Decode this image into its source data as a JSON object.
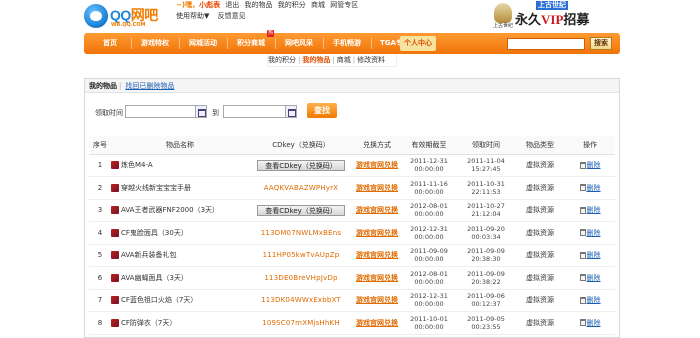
{
  "header": {
    "logo_main": "QQ",
    "logo_accent": "网吧",
    "logo_url": "WB.QQ.COM",
    "greet": "~)嘿，",
    "username": "小彪表",
    "links_row1": [
      "退出",
      "我的物品",
      "我的积分",
      "商城",
      "网管专区"
    ],
    "links_row2": [
      "使用帮助▼",
      "反馈意见"
    ]
  },
  "banner": {
    "tag": "上古世纪",
    "main_prefix": "永久",
    "main_vip": "VIP",
    "main_suffix": "招募",
    "small": "上古世纪"
  },
  "nav": {
    "items": [
      "首页",
      "游戏特权",
      "网城活动",
      "积分商城",
      "网吧风采",
      "手机畅游",
      "TGA专区",
      "个人中心"
    ],
    "badge": "热",
    "search_button": "搜索"
  },
  "subnav": [
    "我的积分",
    "我的物品",
    "商城",
    "修改资料"
  ],
  "tabs": {
    "active": "我的物品",
    "other": "找回已删除物品"
  },
  "filter": {
    "label": "领取时间",
    "to": "到",
    "button": "查找"
  },
  "table": {
    "headers": [
      "序号",
      "物品名称",
      "CDkey（兑换码）",
      "兑换方式",
      "有效期截至",
      "领取时间",
      "物品类型",
      "操作"
    ],
    "rows": [
      {
        "no": "1",
        "name": "炼色M4-A",
        "cdkey": "查看CDkey（兑换码）",
        "is_button": true,
        "method": "游戏官网兑换",
        "expire_d": "2011-12-31",
        "expire_t": "00:00:00",
        "got_d": "2011-11-04",
        "got_t": "15:27:45",
        "type": "虚拟资源",
        "op": "删除"
      },
      {
        "no": "2",
        "name": "穿越火线新宝宝宝手册",
        "cdkey": "AAQKVABAZWPHyrX",
        "is_button": false,
        "method": "游戏官网兑换",
        "expire_d": "2011-11-16",
        "expire_t": "00:00:00",
        "got_d": "2011-10-31",
        "got_t": "22:11:53",
        "type": "虚拟资源",
        "op": "删除"
      },
      {
        "no": "3",
        "name": "AVA王者武器FNF2000（3天）",
        "cdkey": "查看CDkey（兑换码）",
        "is_button": true,
        "method": "游戏官网兑换",
        "expire_d": "2012-08-01",
        "expire_t": "00:00:00",
        "got_d": "2011-10-27",
        "got_t": "21:12:04",
        "type": "虚拟资源",
        "op": "删除"
      },
      {
        "no": "4",
        "name": "CF鬼脸面具（30天）",
        "cdkey": "113DM07NWLMxBEns",
        "is_button": false,
        "method": "游戏官网兑换",
        "expire_d": "2012-12-31",
        "expire_t": "00:00:00",
        "got_d": "2011-09-20",
        "got_t": "00:03:34",
        "type": "虚拟资源",
        "op": "删除"
      },
      {
        "no": "5",
        "name": "AVA新兵装备礼包",
        "cdkey": "111HP05kwTvAUpZp",
        "is_button": false,
        "method": "游戏官网兑换",
        "expire_d": "2011-09-09",
        "expire_t": "00:00:00",
        "got_d": "2011-09-09",
        "got_t": "20:38:30",
        "type": "虚拟资源",
        "op": "删除"
      },
      {
        "no": "6",
        "name": "AVA幽蝇面具（3天）",
        "cdkey": "113DE0BreVHpJvDp",
        "is_button": false,
        "method": "游戏官网兑换",
        "expire_d": "2012-08-01",
        "expire_t": "00:00:00",
        "got_d": "2011-09-09",
        "got_t": "20:38:22",
        "type": "虚拟资源",
        "op": "删除"
      },
      {
        "no": "7",
        "name": "CF蓝色祖口火焰（7天）",
        "cdkey": "113DK04WWxExbbXT",
        "is_button": false,
        "method": "游戏官网兑换",
        "expire_d": "2012-12-31",
        "expire_t": "00:00:00",
        "got_d": "2011-09-06",
        "got_t": "00:12:37",
        "type": "虚拟资源",
        "op": "删除"
      },
      {
        "no": "8",
        "name": "CF防弹衣（7天）",
        "cdkey": "109SC07mXMjsHhKH",
        "is_button": false,
        "method": "游戏官网兑换",
        "expire_d": "2011-10-01",
        "expire_t": "00:00:00",
        "got_d": "2011-09-05",
        "got_t": "00:23:55",
        "type": "虚拟资源",
        "op": "删除"
      }
    ]
  },
  "colors": {
    "accent": "#f07d00",
    "nav_bg": "#f07409",
    "link": "#1a5fb4"
  }
}
